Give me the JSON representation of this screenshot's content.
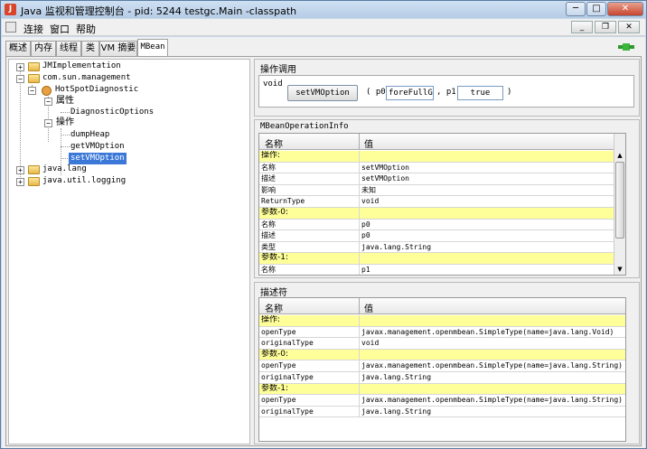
{
  "window": {
    "title": "Java 监视和管理控制台 - pid: 5244 testgc.Main -classpath",
    "app_icon": "java-icon",
    "controls": {
      "minimize": "─",
      "maximize": "□",
      "close": "✕"
    }
  },
  "menubar": {
    "items": [
      "连接",
      "窗口",
      "帮助"
    ],
    "mdi_controls": {
      "minimize": "_",
      "restore": "❐",
      "close": "✕"
    },
    "connection_icon": "plug-connected-icon"
  },
  "tabs": [
    "概述",
    "内存",
    "线程",
    "类",
    "VM 摘要",
    "MBean"
  ],
  "tree": {
    "nodes": {
      "jmimpl": "JMImplementation",
      "comsun": "com.sun.management",
      "hotspot": "HotSpotDiagnostic",
      "attrs": "属性",
      "diagopts": "DiagnosticOptions",
      "ops": "操作",
      "dumpheap": "dumpHeap",
      "getvm": "getVMOption",
      "setvm": "setVMOption",
      "javalang": "java.lang",
      "logging": "java.util.logging"
    }
  },
  "operation": {
    "section_title": "操作调用",
    "return_type": "void",
    "button_label": "setVMOption",
    "open_paren": "( p0",
    "p0_value": "foreFullGC",
    "comma_p1": ", p1",
    "p1_value": "true",
    "close_paren": ")"
  },
  "info": {
    "section_title": "MBeanOperationInfo",
    "col_name": "名称",
    "col_value": "值",
    "rows": [
      {
        "name": "操作:",
        "value": "",
        "group": true
      },
      {
        "name": "名称",
        "value": "setVMOption"
      },
      {
        "name": "描述",
        "value": "setVMOption"
      },
      {
        "name": "影响",
        "value": "未知"
      },
      {
        "name": "ReturnType",
        "value": "void"
      },
      {
        "name": "参数-0:",
        "value": "",
        "group": true
      },
      {
        "name": "名称",
        "value": "p0"
      },
      {
        "name": "描述",
        "value": "p0"
      },
      {
        "name": "类型",
        "value": "java.lang.String"
      },
      {
        "name": "参数-1:",
        "value": "",
        "group": true
      },
      {
        "name": "名称",
        "value": "p1"
      }
    ]
  },
  "descriptor": {
    "section_title": "描述符",
    "col_name": "名称",
    "col_value": "值",
    "rows": [
      {
        "name": "操作:",
        "value": "",
        "group": true
      },
      {
        "name": "openType",
        "value": "javax.management.openmbean.SimpleType(name=java.lang.Void)"
      },
      {
        "name": "originalType",
        "value": "void"
      },
      {
        "name": "参数-0:",
        "value": "",
        "group": true
      },
      {
        "name": "openType",
        "value": "javax.management.openmbean.SimpleType(name=java.lang.String)"
      },
      {
        "name": "originalType",
        "value": "java.lang.String"
      },
      {
        "name": "参数-1:",
        "value": "",
        "group": true
      },
      {
        "name": "openType",
        "value": "javax.management.openmbean.SimpleType(name=java.lang.String)"
      },
      {
        "name": "originalType",
        "value": "java.lang.String"
      }
    ]
  }
}
